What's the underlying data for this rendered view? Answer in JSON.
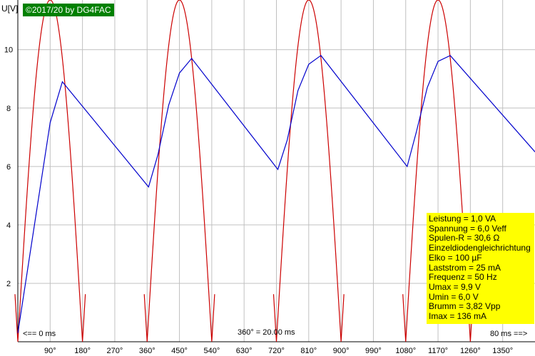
{
  "copyright": "©2017/20 by DG4FAC",
  "info": [
    "Leistung = 1,0 VA",
    "Spannung = 6,0 Veff",
    "Spulen-R = 30,6 Ω",
    "Einzeldiodengleichrichtung",
    "Elko = 100 µF",
    "Laststrom = 25 mA",
    "Frequenz = 50 Hz",
    "Umax = 9,9 V",
    "Umin = 6,0 V",
    "Brumm = 3,82 Vpp",
    "Imax = 136 mA"
  ],
  "annotations": {
    "start": "<== 0 ms",
    "period": "360° = 20.00 ms",
    "end": "80 ms ==>"
  },
  "colors": {
    "grid": "#c0c0c0",
    "sine": "#cc0000",
    "capacitor": "#0000cc",
    "copyright_bg": "#008000",
    "info_bg": "#ffff00"
  },
  "chart_data": {
    "type": "line",
    "xlabel": "",
    "ylabel": "U[V]",
    "xlim": [
      0,
      1440
    ],
    "ylim": [
      0,
      11.7
    ],
    "x_ticks": [
      "90°",
      "180°",
      "270°",
      "360°",
      "450°",
      "540°",
      "630°",
      "720°",
      "810°",
      "900°",
      "990°",
      "1080°",
      "1170°",
      "1260°",
      "1350°"
    ],
    "x_tick_values": [
      90,
      180,
      270,
      360,
      450,
      540,
      630,
      720,
      810,
      900,
      990,
      1080,
      1170,
      1260,
      1350
    ],
    "y_ticks": [
      "2",
      "4",
      "6",
      "8",
      "10"
    ],
    "y_tick_values": [
      2,
      4,
      6,
      8,
      10
    ],
    "grid": true,
    "series": [
      {
        "style": "rectified-sine",
        "peak": 11.7,
        "period_deg": 360,
        "visible_ranges": [
          [
            0,
            180
          ],
          [
            360,
            540
          ],
          [
            720,
            900
          ],
          [
            1080,
            1260
          ]
        ]
      },
      {
        "style": "capacitor-voltage",
        "x": [
          0,
          45,
          90,
          124,
          364,
          390,
          420,
          450,
          484,
          724,
          750,
          780,
          810,
          844,
          1084,
          1110,
          1140,
          1170,
          1204,
          1440
        ],
        "y": [
          0.3,
          3.9,
          7.5,
          8.9,
          5.3,
          6.4,
          8.1,
          9.2,
          9.7,
          5.9,
          6.9,
          8.6,
          9.5,
          9.8,
          6.0,
          7.2,
          8.7,
          9.6,
          9.8,
          6.5
        ]
      }
    ]
  }
}
